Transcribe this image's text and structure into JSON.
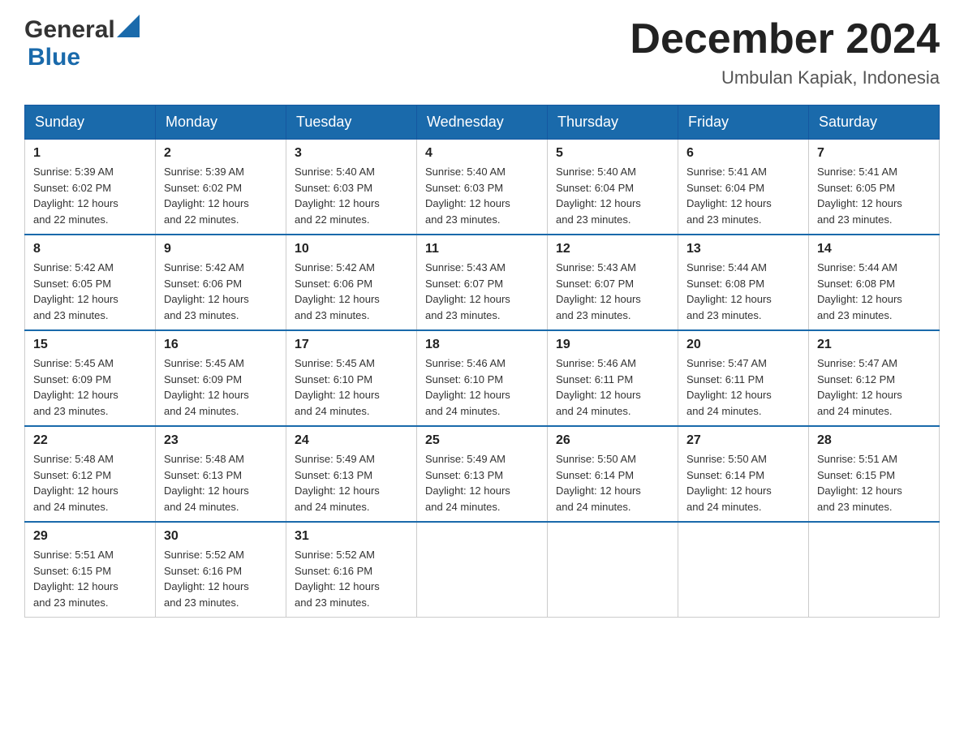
{
  "header": {
    "logo_general": "General",
    "logo_blue": "Blue",
    "month_title": "December 2024",
    "location": "Umbulan Kapiak, Indonesia"
  },
  "days_of_week": [
    "Sunday",
    "Monday",
    "Tuesday",
    "Wednesday",
    "Thursday",
    "Friday",
    "Saturday"
  ],
  "weeks": [
    [
      {
        "day": "1",
        "sunrise": "5:39 AM",
        "sunset": "6:02 PM",
        "daylight": "12 hours and 22 minutes."
      },
      {
        "day": "2",
        "sunrise": "5:39 AM",
        "sunset": "6:02 PM",
        "daylight": "12 hours and 22 minutes."
      },
      {
        "day": "3",
        "sunrise": "5:40 AM",
        "sunset": "6:03 PM",
        "daylight": "12 hours and 22 minutes."
      },
      {
        "day": "4",
        "sunrise": "5:40 AM",
        "sunset": "6:03 PM",
        "daylight": "12 hours and 23 minutes."
      },
      {
        "day": "5",
        "sunrise": "5:40 AM",
        "sunset": "6:04 PM",
        "daylight": "12 hours and 23 minutes."
      },
      {
        "day": "6",
        "sunrise": "5:41 AM",
        "sunset": "6:04 PM",
        "daylight": "12 hours and 23 minutes."
      },
      {
        "day": "7",
        "sunrise": "5:41 AM",
        "sunset": "6:05 PM",
        "daylight": "12 hours and 23 minutes."
      }
    ],
    [
      {
        "day": "8",
        "sunrise": "5:42 AM",
        "sunset": "6:05 PM",
        "daylight": "12 hours and 23 minutes."
      },
      {
        "day": "9",
        "sunrise": "5:42 AM",
        "sunset": "6:06 PM",
        "daylight": "12 hours and 23 minutes."
      },
      {
        "day": "10",
        "sunrise": "5:42 AM",
        "sunset": "6:06 PM",
        "daylight": "12 hours and 23 minutes."
      },
      {
        "day": "11",
        "sunrise": "5:43 AM",
        "sunset": "6:07 PM",
        "daylight": "12 hours and 23 minutes."
      },
      {
        "day": "12",
        "sunrise": "5:43 AM",
        "sunset": "6:07 PM",
        "daylight": "12 hours and 23 minutes."
      },
      {
        "day": "13",
        "sunrise": "5:44 AM",
        "sunset": "6:08 PM",
        "daylight": "12 hours and 23 minutes."
      },
      {
        "day": "14",
        "sunrise": "5:44 AM",
        "sunset": "6:08 PM",
        "daylight": "12 hours and 23 minutes."
      }
    ],
    [
      {
        "day": "15",
        "sunrise": "5:45 AM",
        "sunset": "6:09 PM",
        "daylight": "12 hours and 23 minutes."
      },
      {
        "day": "16",
        "sunrise": "5:45 AM",
        "sunset": "6:09 PM",
        "daylight": "12 hours and 24 minutes."
      },
      {
        "day": "17",
        "sunrise": "5:45 AM",
        "sunset": "6:10 PM",
        "daylight": "12 hours and 24 minutes."
      },
      {
        "day": "18",
        "sunrise": "5:46 AM",
        "sunset": "6:10 PM",
        "daylight": "12 hours and 24 minutes."
      },
      {
        "day": "19",
        "sunrise": "5:46 AM",
        "sunset": "6:11 PM",
        "daylight": "12 hours and 24 minutes."
      },
      {
        "day": "20",
        "sunrise": "5:47 AM",
        "sunset": "6:11 PM",
        "daylight": "12 hours and 24 minutes."
      },
      {
        "day": "21",
        "sunrise": "5:47 AM",
        "sunset": "6:12 PM",
        "daylight": "12 hours and 24 minutes."
      }
    ],
    [
      {
        "day": "22",
        "sunrise": "5:48 AM",
        "sunset": "6:12 PM",
        "daylight": "12 hours and 24 minutes."
      },
      {
        "day": "23",
        "sunrise": "5:48 AM",
        "sunset": "6:13 PM",
        "daylight": "12 hours and 24 minutes."
      },
      {
        "day": "24",
        "sunrise": "5:49 AM",
        "sunset": "6:13 PM",
        "daylight": "12 hours and 24 minutes."
      },
      {
        "day": "25",
        "sunrise": "5:49 AM",
        "sunset": "6:13 PM",
        "daylight": "12 hours and 24 minutes."
      },
      {
        "day": "26",
        "sunrise": "5:50 AM",
        "sunset": "6:14 PM",
        "daylight": "12 hours and 24 minutes."
      },
      {
        "day": "27",
        "sunrise": "5:50 AM",
        "sunset": "6:14 PM",
        "daylight": "12 hours and 24 minutes."
      },
      {
        "day": "28",
        "sunrise": "5:51 AM",
        "sunset": "6:15 PM",
        "daylight": "12 hours and 23 minutes."
      }
    ],
    [
      {
        "day": "29",
        "sunrise": "5:51 AM",
        "sunset": "6:15 PM",
        "daylight": "12 hours and 23 minutes."
      },
      {
        "day": "30",
        "sunrise": "5:52 AM",
        "sunset": "6:16 PM",
        "daylight": "12 hours and 23 minutes."
      },
      {
        "day": "31",
        "sunrise": "5:52 AM",
        "sunset": "6:16 PM",
        "daylight": "12 hours and 23 minutes."
      },
      null,
      null,
      null,
      null
    ]
  ],
  "labels": {
    "sunrise": "Sunrise:",
    "sunset": "Sunset:",
    "daylight": "Daylight:"
  }
}
